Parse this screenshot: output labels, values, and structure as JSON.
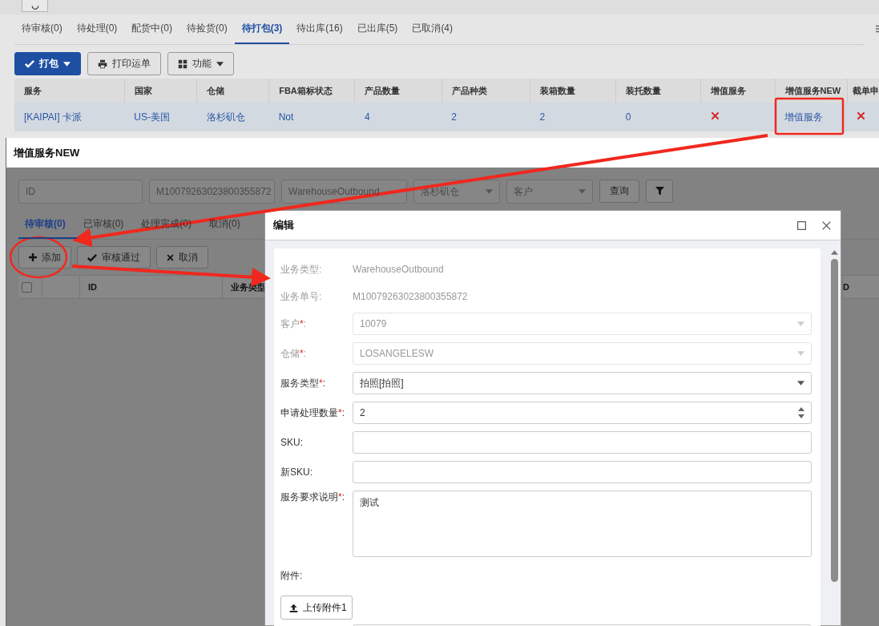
{
  "order_page": {
    "tabs": [
      {
        "label": "待审核(0)",
        "selected": false
      },
      {
        "label": "待处理(0)",
        "selected": false
      },
      {
        "label": "配货中(0)",
        "selected": false
      },
      {
        "label": "待捡货(0)",
        "selected": false
      },
      {
        "label": "待打包(3)",
        "selected": true
      },
      {
        "label": "待出库(16)",
        "selected": false
      },
      {
        "label": "已出库(5)",
        "selected": false
      },
      {
        "label": "已取消(4)",
        "selected": false
      }
    ],
    "toolbar": [
      {
        "kind": "primary",
        "label": "打包"
      },
      {
        "kind": "print",
        "label": "打印运单"
      },
      {
        "kind": "menu",
        "label": "功能"
      }
    ],
    "table": {
      "columns": [
        "服务",
        "国家",
        "仓储",
        "FBA箱标状态",
        "产品数量",
        "产品种类",
        "装箱数量",
        "装托数量",
        "增值服务",
        "增值服务NEW",
        "截单申"
      ],
      "rows": [
        {
          "cells": [
            {
              "kind": "text",
              "text": "[KAIPAI] 卡派"
            },
            {
              "kind": "text",
              "text": "US-美国"
            },
            {
              "kind": "text",
              "text": "洛杉矶仓"
            },
            {
              "kind": "text",
              "text": "Not"
            },
            {
              "kind": "text",
              "text": "4"
            },
            {
              "kind": "text",
              "text": "2"
            },
            {
              "kind": "text",
              "text": "2"
            },
            {
              "kind": "text",
              "text": "0"
            },
            {
              "kind": "cross"
            },
            {
              "kind": "link",
              "text": "增值服务"
            },
            {
              "kind": "cross"
            }
          ]
        }
      ]
    }
  },
  "vas_dialog": {
    "title": "增值服务NEW",
    "filters": [
      {
        "kind": "input",
        "placeholder": "ID"
      },
      {
        "kind": "input",
        "value": "M10079263023800355872"
      },
      {
        "kind": "input",
        "value": "WarehouseOutbound"
      },
      {
        "kind": "select",
        "value": "洛杉矶仓"
      },
      {
        "kind": "select",
        "placeholder": "客户"
      },
      {
        "kind": "button",
        "label": "查询"
      },
      {
        "kind": "filter"
      }
    ],
    "tabs": [
      {
        "label": "待审核(0)",
        "selected": true
      },
      {
        "label": "已审核(0)",
        "selected": false
      },
      {
        "label": "处理完成(0)",
        "selected": false
      },
      {
        "label": "取消(0)",
        "selected": false
      }
    ],
    "toolbar": [
      {
        "kind": "add",
        "label": "添加"
      },
      {
        "kind": "approve",
        "label": "审核通过"
      },
      {
        "kind": "cancel",
        "label": "取消"
      }
    ],
    "table": {
      "select_all": {
        "checked": false
      },
      "columns": [
        "ID",
        "业务类型",
        "D"
      ]
    }
  },
  "edit_dialog": {
    "title": "编辑",
    "fields": [
      {
        "kind": "static",
        "label": "业务类型",
        "colon": ":",
        "value": "WarehouseOutbound",
        "disabled": true
      },
      {
        "kind": "static",
        "label": "业务单号",
        "colon": ":",
        "value": "M10079263023800355872",
        "disabled": true
      },
      {
        "kind": "select",
        "label": "客户",
        "required_mark": "*",
        "colon": ":",
        "value": "10079",
        "disabled": true
      },
      {
        "kind": "select",
        "label": "仓储",
        "required_mark": "*",
        "colon": ":",
        "value": "LOSANGELESW",
        "disabled": true
      },
      {
        "kind": "select",
        "label": "服务类型",
        "required_mark": "*",
        "colon": ":",
        "value": "拍照[拍照]",
        "disabled": false
      },
      {
        "kind": "number",
        "label": "申请处理数量",
        "required_mark": "*",
        "colon": ":",
        "value": "2",
        "disabled": false
      },
      {
        "kind": "input",
        "label": "SKU",
        "colon": ":",
        "disabled": false
      },
      {
        "kind": "input",
        "label": "新SKU",
        "colon": ":",
        "disabled": false
      },
      {
        "kind": "textarea",
        "label": "服务要求说明",
        "required_mark": "*",
        "colon": ":",
        "value": "测试",
        "disabled": false
      },
      {
        "kind": "label",
        "label": "附件",
        "colon": ":",
        "disabled": false
      },
      {
        "kind": "upload",
        "label": "上传附件1"
      },
      {
        "kind": "input"
      }
    ]
  }
}
